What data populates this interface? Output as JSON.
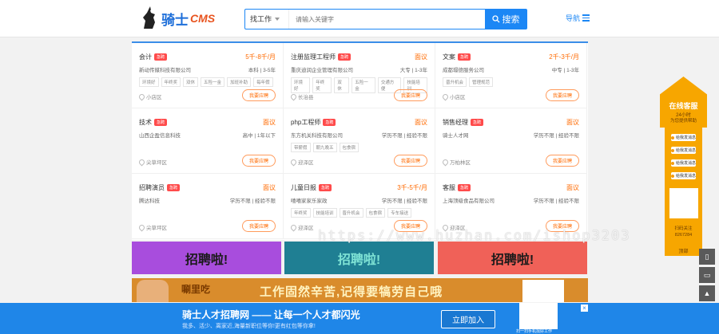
{
  "header": {
    "logo_text": "骑士",
    "logo_cms": "CMS",
    "search_select": "找工作",
    "search_placeholder": "请输入关键字",
    "search_button": "搜索",
    "nav_label": "导航"
  },
  "jobs": [
    {
      "title": "会计",
      "badge": "急聘",
      "salary": "5千-8千/月",
      "company": "新动传媒科技有限公司",
      "req": "本科 | 3-5年",
      "tags": [
        "环境好",
        "年终奖",
        "双休",
        "五险一金",
        "加班补助",
        "每年假"
      ],
      "location": "小店区",
      "apply": "我要应聘"
    },
    {
      "title": "注册监理工程师",
      "badge": "急聘",
      "salary": "面议",
      "company": "重庆迪润企业管理有限公司",
      "req": "大专 | 1-3年",
      "tags": [
        "环境好",
        "年终奖",
        "双休",
        "五险一金",
        "交通方便",
        "技能培训"
      ],
      "location": "长治县",
      "apply": "我要应聘"
    },
    {
      "title": "文案",
      "badge": "急聘",
      "salary": "2千-3千/月",
      "company": "成都璟德服务公司",
      "req": "中专 | 1-3年",
      "tags": [
        "晋升机会",
        "管理规范"
      ],
      "location": "小店区",
      "apply": "我要应聘"
    },
    {
      "title": "技术",
      "badge": "急聘",
      "salary": "面议",
      "company": "山西企盈信息科技",
      "req": "高中 | 1年以下",
      "tags": [],
      "location": "尖草坪区",
      "apply": "我要应聘"
    },
    {
      "title": "php工程师",
      "badge": "急聘",
      "salary": "面议",
      "company": "东方机关科技有限公司",
      "req": "学历不限 | 经验不限",
      "tags": [
        "带薪假",
        "朝九晚五",
        "包食宿"
      ],
      "location": "迎泽区",
      "apply": "我要应聘"
    },
    {
      "title": "销售经理",
      "badge": "急聘",
      "salary": "面议",
      "company": "骑士人才网",
      "req": "学历不限 | 经验不限",
      "tags": [],
      "location": "万柏林区",
      "apply": "我要应聘"
    },
    {
      "title": "招聘演员",
      "badge": "急聘",
      "salary": "面议",
      "company": "腾达科技",
      "req": "学历不限 | 经验不限",
      "tags": [],
      "location": "尖草坪区",
      "apply": "我要应聘"
    },
    {
      "title": "儿童日报",
      "badge": "急聘",
      "salary": "3千-5千/月",
      "company": "嘻嘻家家乐家政",
      "req": "学历不限 | 经验不限",
      "tags": [
        "年终奖",
        "技能培训",
        "晋升机会",
        "包食宿",
        "专车接送"
      ],
      "location": "迎泽区",
      "apply": "我要应聘"
    },
    {
      "title": "客服",
      "badge": "急聘",
      "salary": "面议",
      "company": "上海顶级食品有限公司",
      "req": "学历不限 | 经验不限",
      "tags": [],
      "location": "迎泽区",
      "apply": "我要应聘"
    }
  ],
  "banners": [
    "招聘啦!",
    "招聘啦!",
    "招聘啦!"
  ],
  "ad": {
    "brand": "唰里吃",
    "slogan": "工作固然辛苦,记得要犒劳自己哦"
  },
  "bottom_bar": {
    "title": "骑士人才招聘网 —— 让每一个人才都闪光",
    "subtitle": "我多、活少、离家近,海量新职位等你!更有红包等你拿!",
    "join_button": "立即加入",
    "qr_caption": "扫一扫手机找好工作",
    "close": "×"
  },
  "kefu": {
    "title": "在线客服",
    "hours": "24小时",
    "help": "为您提供帮助",
    "qq_label": "给我发消息",
    "follow": "扫码关注",
    "phone": "8267284",
    "top": "顶部"
  },
  "watermark": "https://www.huzhan.com/ishop3203"
}
